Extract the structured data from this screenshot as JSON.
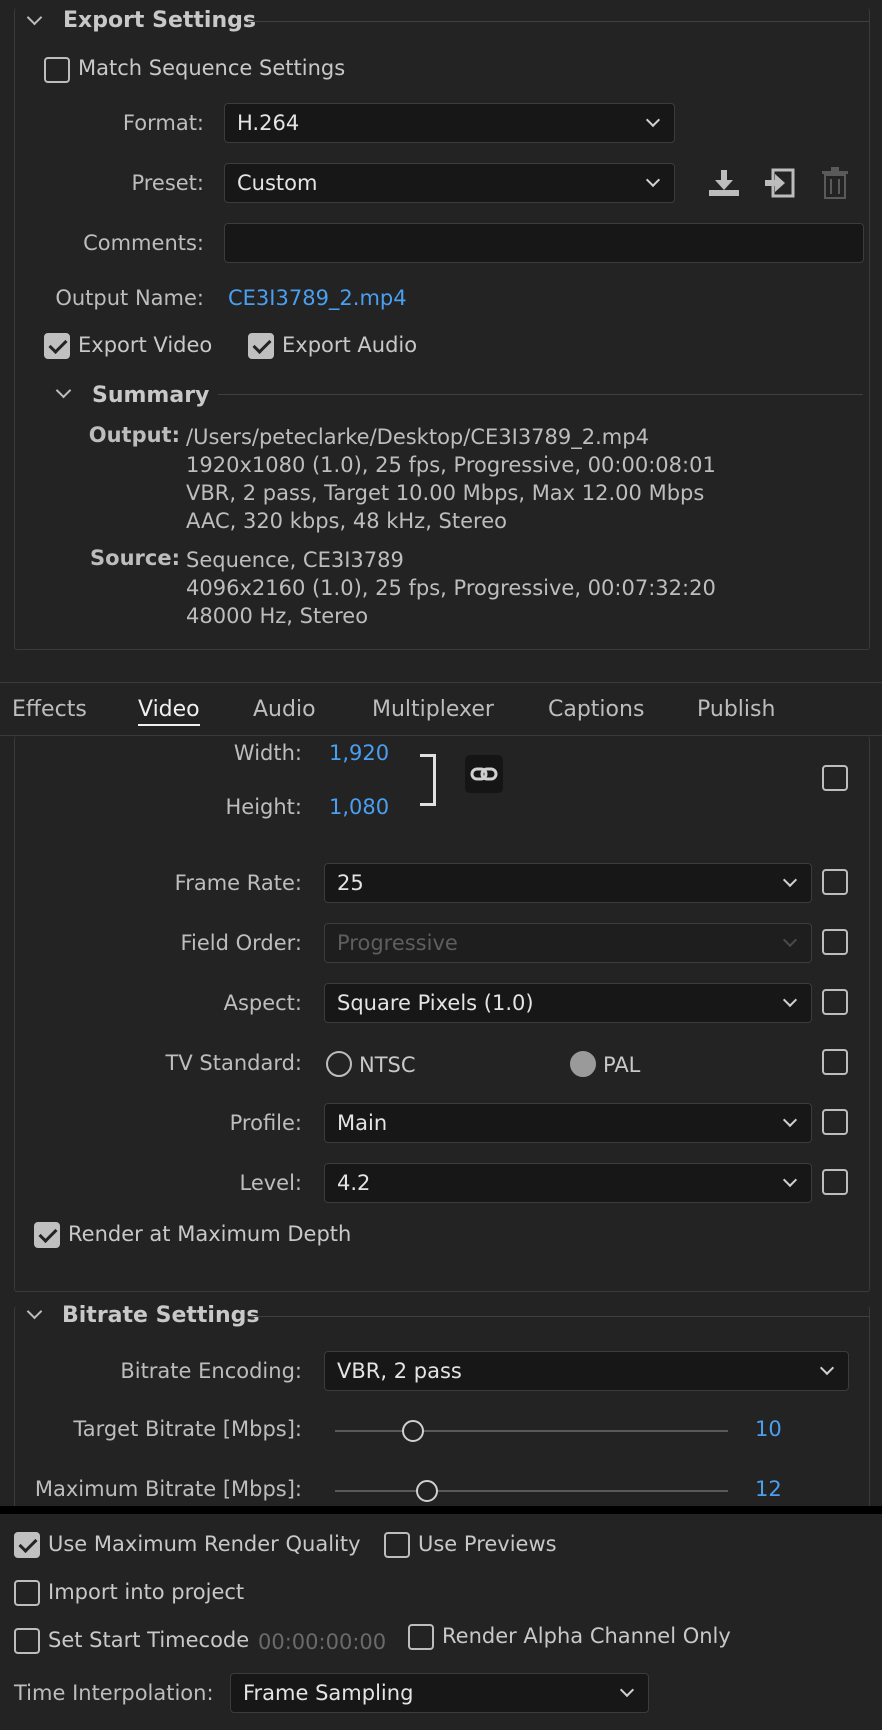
{
  "export_settings": {
    "section_title": "Export Settings",
    "match_sequence_label": "Match Sequence Settings",
    "match_sequence_checked": false,
    "format_label": "Format:",
    "format_value": "H.264",
    "preset_label": "Preset:",
    "preset_value": "Custom",
    "comments_label": "Comments:",
    "comments_value": "",
    "output_name_label": "Output Name:",
    "output_name_value": "CE3I3789_2.mp4",
    "export_video_label": "Export Video",
    "export_video_checked": true,
    "export_audio_label": "Export Audio",
    "export_audio_checked": true,
    "icons": [
      "save-preset-icon",
      "import-preset-icon",
      "delete-preset-icon"
    ]
  },
  "summary": {
    "title": "Summary",
    "output_label": "Output:",
    "output_lines": [
      "/Users/peteclarke/Desktop/CE3I3789_2.mp4",
      "1920x1080 (1.0), 25 fps, Progressive, 00:00:08:01",
      "VBR, 2 pass, Target 10.00 Mbps, Max 12.00 Mbps",
      "AAC, 320 kbps, 48 kHz, Stereo"
    ],
    "source_label": "Source:",
    "source_lines": [
      "Sequence, CE3I3789",
      "4096x2160 (1.0), 25 fps, Progressive, 00:07:32:20",
      "48000 Hz, Stereo"
    ]
  },
  "tabs": [
    {
      "label": "Effects",
      "active": false
    },
    {
      "label": "Video",
      "active": true
    },
    {
      "label": "Audio",
      "active": false
    },
    {
      "label": "Multiplexer",
      "active": false
    },
    {
      "label": "Captions",
      "active": false
    },
    {
      "label": "Publish",
      "active": false
    }
  ],
  "video": {
    "width_label": "Width:",
    "width_value": "1,920",
    "height_label": "Height:",
    "height_value": "1,080",
    "frame_rate_label": "Frame Rate:",
    "frame_rate_value": "25",
    "field_order_label": "Field Order:",
    "field_order_value": "Progressive",
    "aspect_label": "Aspect:",
    "aspect_value": "Square Pixels (1.0)",
    "tv_standard_label": "TV Standard:",
    "ntsc_label": "NTSC",
    "pal_label": "PAL",
    "tv_standard_selected": "PAL",
    "profile_label": "Profile:",
    "profile_value": "Main",
    "level_label": "Level:",
    "level_value": "4.2",
    "render_max_depth_label": "Render at Maximum Depth",
    "render_max_depth_checked": true
  },
  "bitrate": {
    "section_title": "Bitrate Settings",
    "encoding_label": "Bitrate Encoding:",
    "encoding_value": "VBR, 2 pass",
    "target_label": "Target Bitrate [Mbps]:",
    "target_value": "10",
    "target_fraction": 0.2,
    "max_label": "Maximum Bitrate [Mbps]:",
    "max_value": "12",
    "max_fraction": 0.24
  },
  "bottom": {
    "use_max_render_label": "Use Maximum Render Quality",
    "use_max_render_checked": true,
    "use_previews_label": "Use Previews",
    "use_previews_checked": false,
    "import_label": "Import into project",
    "import_checked": false,
    "start_timecode_label": "Set Start Timecode",
    "start_timecode_checked": false,
    "start_timecode_value": "00:00:00:00",
    "alpha_only_label": "Render Alpha Channel Only",
    "alpha_only_checked": false,
    "time_interp_label": "Time Interpolation:",
    "time_interp_value": "Frame Sampling"
  }
}
